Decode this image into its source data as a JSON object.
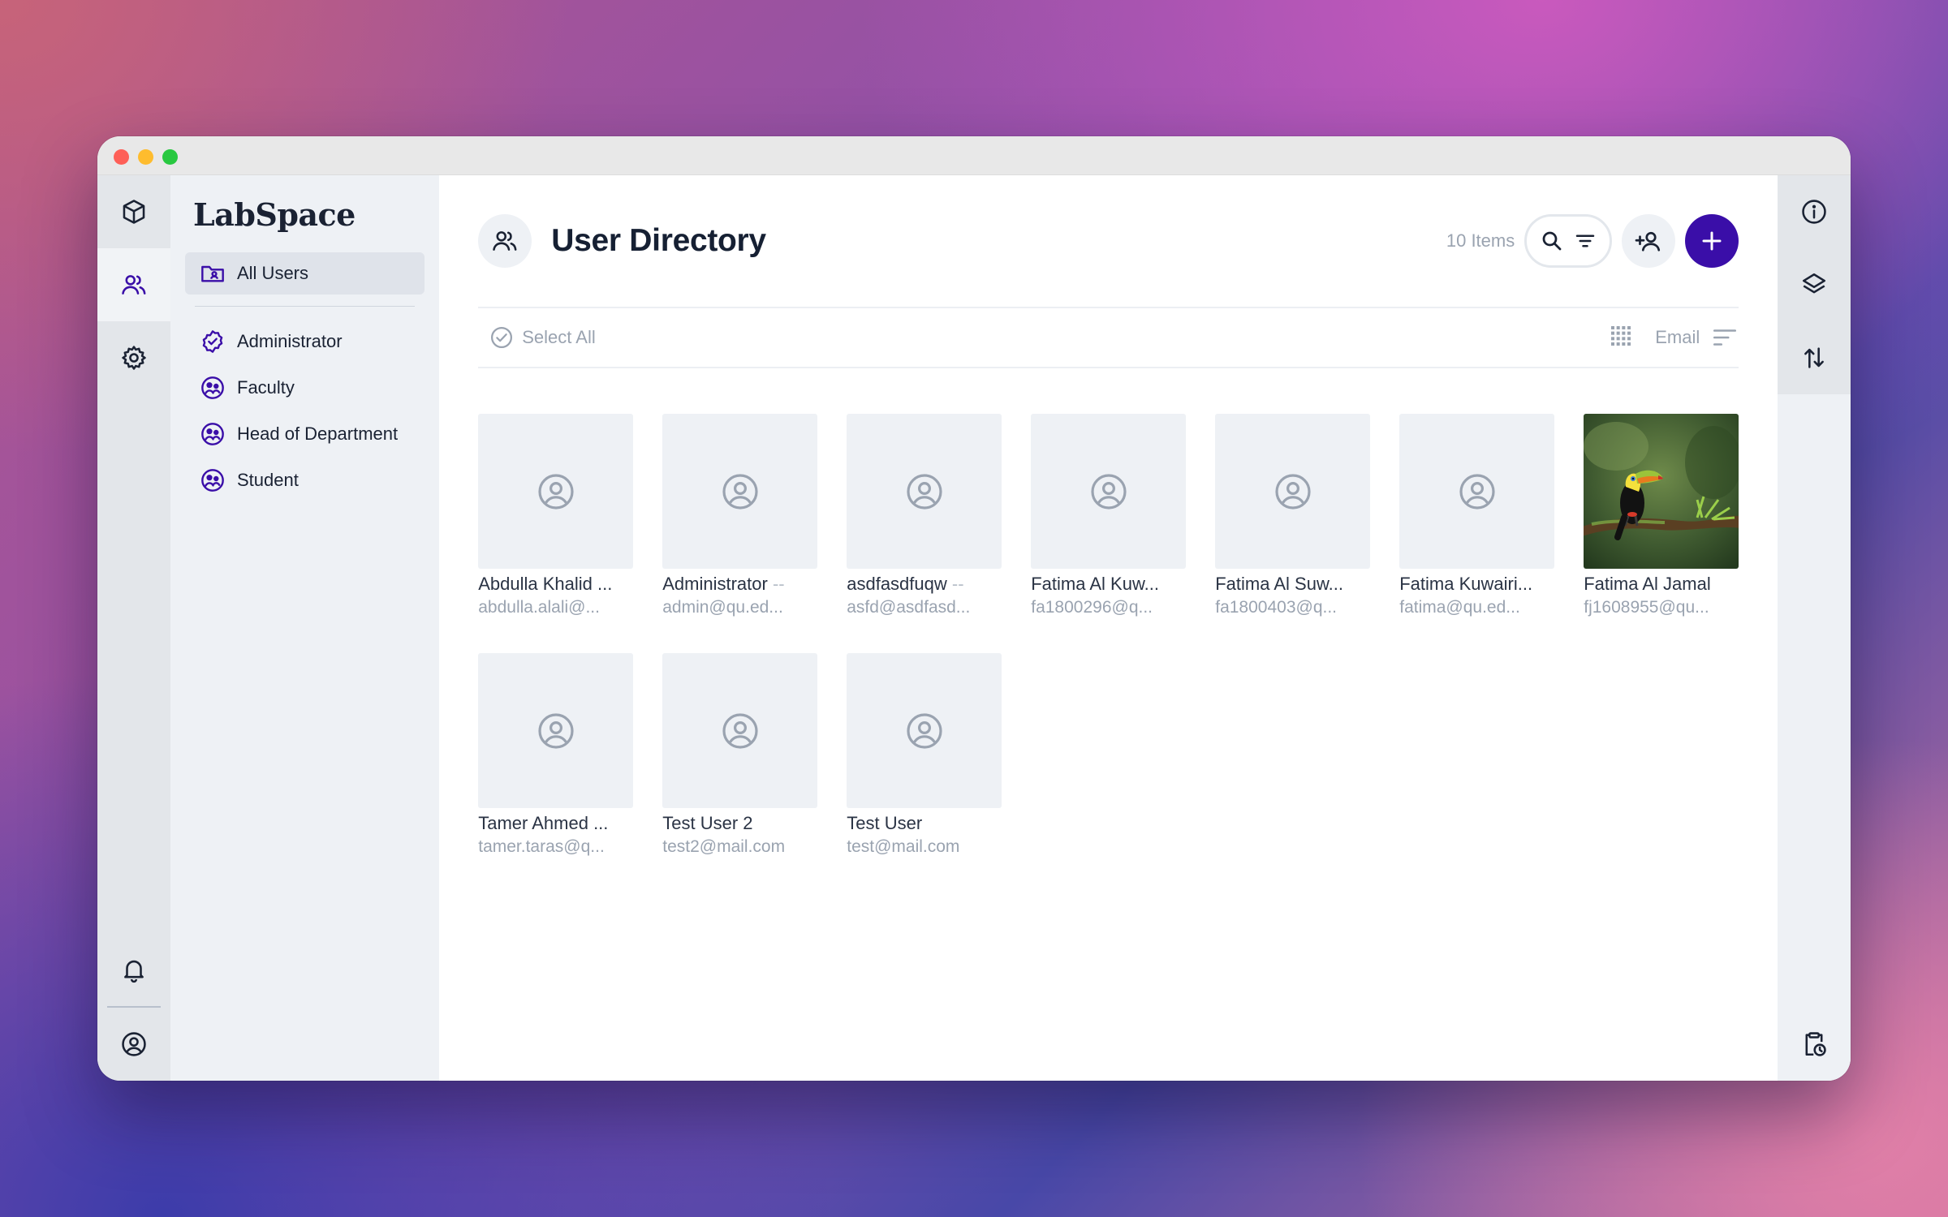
{
  "app": {
    "brand": "LabSpace"
  },
  "sidebar": {
    "all_users_label": "All Users",
    "roles": [
      {
        "label": "Administrator",
        "icon": "verified-badge-icon"
      },
      {
        "label": "Faculty",
        "icon": "group-face-icon"
      },
      {
        "label": "Head of Department",
        "icon": "group-face-icon"
      },
      {
        "label": "Student",
        "icon": "group-face-icon"
      }
    ]
  },
  "header": {
    "title": "User Directory",
    "items_count": "10 Items"
  },
  "toolbar": {
    "select_all": "Select All",
    "sort_label": "Email"
  },
  "users": [
    {
      "name": "Abdulla Khalid ...",
      "suffix": "",
      "email": "abdulla.alali@..."
    },
    {
      "name": "Administrator",
      "suffix": " --",
      "email": "admin@qu.ed..."
    },
    {
      "name": "asdfasdfuqw",
      "suffix": " --",
      "email": "asfd@asdfasd..."
    },
    {
      "name": "Fatima Al Kuw...",
      "suffix": "",
      "email": "fa1800296@q..."
    },
    {
      "name": "Fatima Al Suw...",
      "suffix": "",
      "email": "fa1800403@q..."
    },
    {
      "name": "Fatima Kuwairi...",
      "suffix": "",
      "email": "fatima@qu.ed..."
    },
    {
      "name": "Fatima Al Jamal",
      "suffix": "",
      "email": "fj1608955@qu...",
      "photo": "toucan"
    },
    {
      "name": "Tamer Ahmed ...",
      "suffix": "",
      "email": "tamer.taras@q..."
    },
    {
      "name": "Test User 2",
      "suffix": "",
      "email": "test2@mail.com"
    },
    {
      "name": "Test User",
      "suffix": "",
      "email": "test@mail.com"
    }
  ],
  "colors": {
    "accent": "#3a0ea8",
    "icon_dark": "#1a2233",
    "muted": "#9aa3b0"
  }
}
